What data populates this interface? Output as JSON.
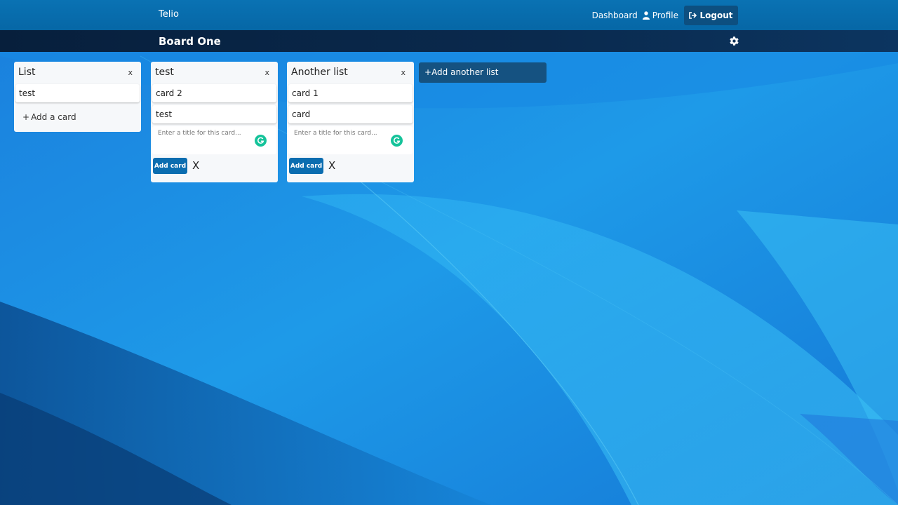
{
  "topbar": {
    "brand": "Telio",
    "dashboard_label": "Dashboard",
    "profile_label": "Profile",
    "logout_label": "Logout"
  },
  "board": {
    "title": "Board One"
  },
  "lists": [
    {
      "title": "List",
      "close": "x",
      "cards": [
        "test"
      ],
      "add_card_plus": "+",
      "add_card_label": "Add a card"
    },
    {
      "title": "test",
      "close": "x",
      "cards": [
        "card 2",
        "test"
      ],
      "composer_placeholder": "Enter a title for this card...",
      "add_button_label": "Add card",
      "cancel_label": "X"
    },
    {
      "title": "Another list",
      "close": "x",
      "cards": [
        "card 1",
        "card"
      ],
      "composer_placeholder": "Enter a title for this card...",
      "add_button_label": "Add card",
      "cancel_label": "X"
    }
  ],
  "add_list": {
    "plus": "+",
    "label": "Add another list"
  },
  "icons": {
    "user": "user-icon",
    "logout": "sign-out-icon",
    "settings": "gear-icon",
    "grammarly": "grammarly-icon"
  },
  "colors": {
    "topbar": "#0a72b3",
    "boardbar": "#0a2a4e",
    "primary_button": "#0b6db0",
    "grammarly": "#15c39a"
  }
}
